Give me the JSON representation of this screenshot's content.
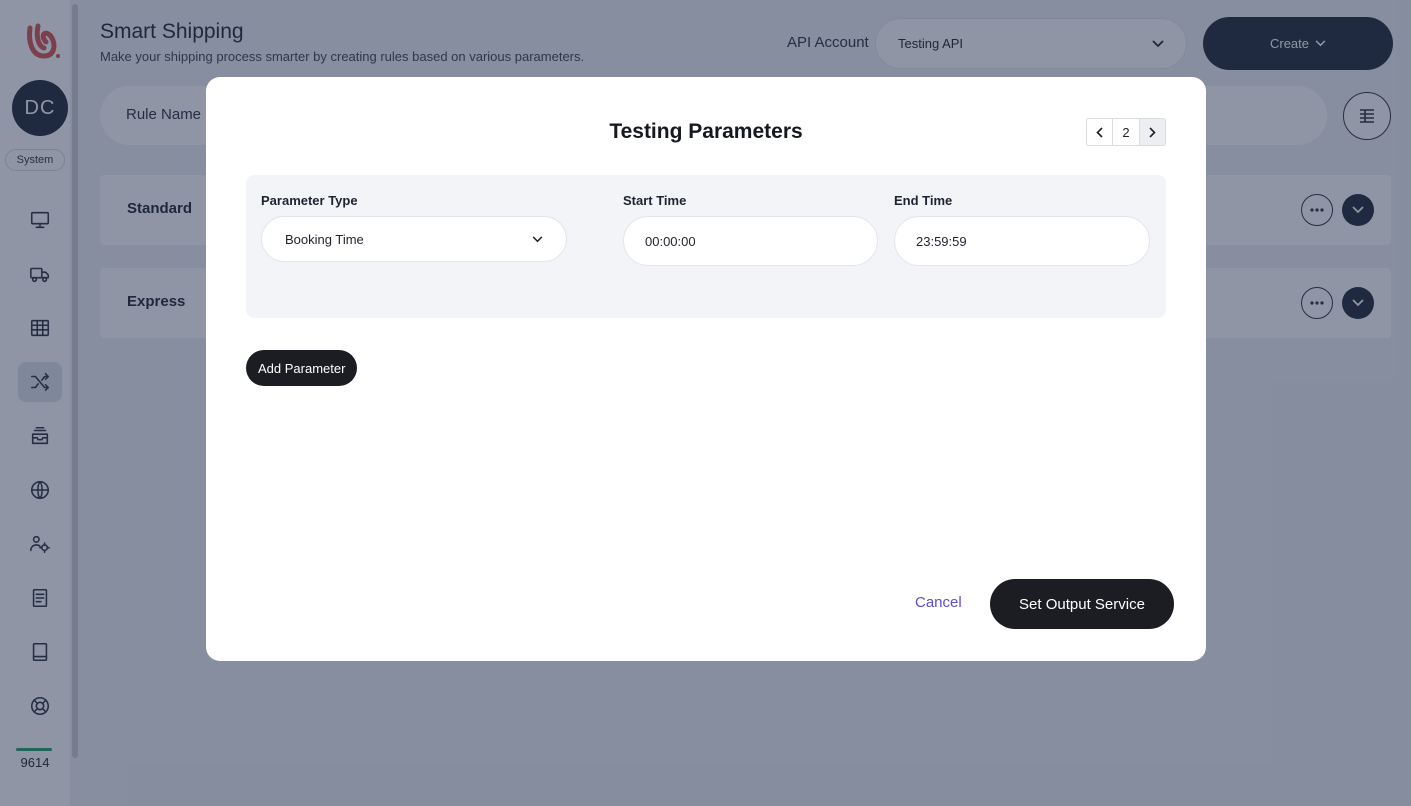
{
  "sidebar": {
    "logo_icon": "brand-logo-icon",
    "avatar_initials": "DC",
    "role_badge": "System",
    "nav_icons": [
      "monitor-icon",
      "truck-icon",
      "table-icon",
      "shuffle-icon",
      "inbox-stack-icon",
      "globe-icon",
      "users-gear-icon",
      "book-icon",
      "tablet-icon",
      "lifebuoy-icon"
    ],
    "active_item": "shuffle-icon",
    "usage_count": "9614",
    "usage_color": "#22a06b"
  },
  "header": {
    "title": "Smart Shipping",
    "subtitle": "Make your shipping process smarter by creating rules based on various parameters.",
    "api_account_label": "API Account",
    "api_account_value": "Testing API",
    "create_label": "Create"
  },
  "filter": {
    "rule_name_label": "Rule Name"
  },
  "rules": [
    {
      "name": "Standard"
    },
    {
      "name": "Express"
    }
  ],
  "modal": {
    "title": "Testing Parameters",
    "pager": {
      "current_page": "2"
    },
    "parameter": {
      "type_label": "Parameter Type",
      "type_value": "Booking Time",
      "start_label": "Start Time",
      "start_value": "00:00:00",
      "end_label": "End Time",
      "end_value": "23:59:59"
    },
    "add_parameter_label": "Add Parameter",
    "cancel_label": "Cancel",
    "submit_label": "Set Output Service"
  },
  "colors": {
    "primary_dark": "#1f2937",
    "link": "#5a4fcf",
    "brand": "#d9534f"
  }
}
